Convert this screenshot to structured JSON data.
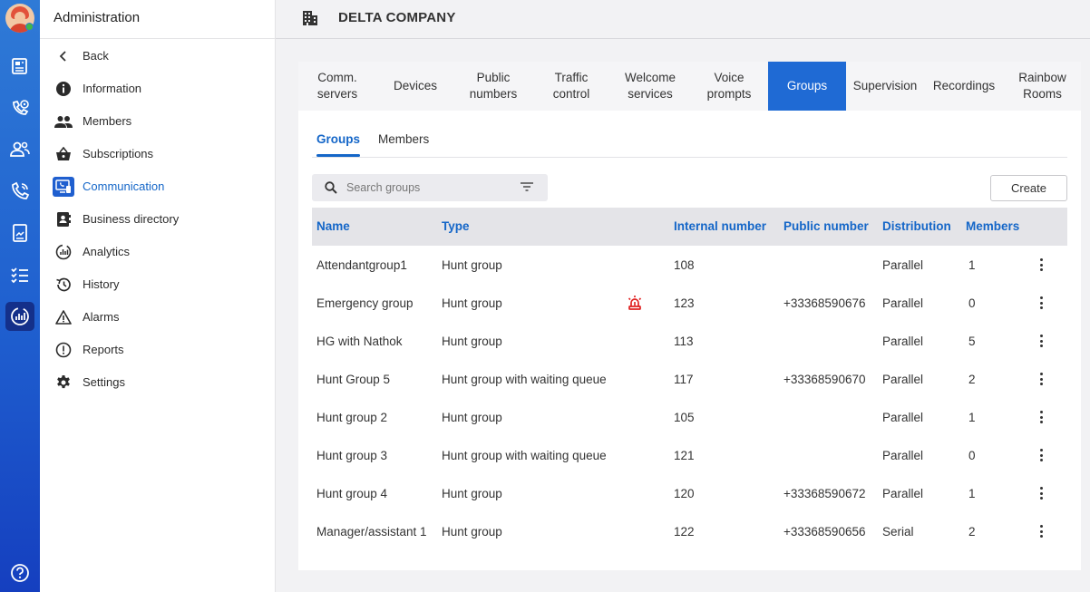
{
  "sidebar_rail": {
    "icons": [
      "avatar",
      "news-icon",
      "phone-settings-icon",
      "contacts-icon",
      "call-icon",
      "document-icon",
      "checklist-icon",
      "admin-dashboard-icon",
      "help-icon"
    ]
  },
  "menu": {
    "title": "Administration",
    "items": [
      {
        "label": "Back",
        "icon": "chevron-left-icon"
      },
      {
        "label": "Information",
        "icon": "info-icon"
      },
      {
        "label": "Members",
        "icon": "people-icon"
      },
      {
        "label": "Subscriptions",
        "icon": "basket-icon"
      },
      {
        "label": "Communication",
        "icon": "communication-icon",
        "selected": true
      },
      {
        "label": "Business directory",
        "icon": "directory-icon"
      },
      {
        "label": "Analytics",
        "icon": "analytics-icon"
      },
      {
        "label": "History",
        "icon": "history-icon"
      },
      {
        "label": "Alarms",
        "icon": "warning-icon"
      },
      {
        "label": "Reports",
        "icon": "report-icon"
      },
      {
        "label": "Settings",
        "icon": "gear-icon"
      }
    ]
  },
  "header": {
    "company": "DELTA COMPANY",
    "icon": "building-icon"
  },
  "tabs": [
    {
      "label": "Comm.\nservers"
    },
    {
      "label": "Devices"
    },
    {
      "label": "Public\nnumbers"
    },
    {
      "label": "Traffic\ncontrol"
    },
    {
      "label": "Welcome\nservices"
    },
    {
      "label": "Voice\nprompts"
    },
    {
      "label": "Groups",
      "active": true
    },
    {
      "label": "Supervision"
    },
    {
      "label": "Recordings"
    },
    {
      "label": "Rainbow\nRooms"
    }
  ],
  "subtabs": [
    {
      "label": "Groups",
      "active": true
    },
    {
      "label": "Members"
    }
  ],
  "search": {
    "placeholder": "Search groups"
  },
  "create_label": "Create",
  "table": {
    "columns": [
      "Name",
      "Type",
      "Internal number",
      "Public number",
      "Distribution",
      "Members"
    ],
    "rows": [
      {
        "name": "Attendantgroup1",
        "type": "Hunt group",
        "alarm": false,
        "internal": "108",
        "public": "",
        "distribution": "Parallel",
        "members": "1"
      },
      {
        "name": "Emergency group",
        "type": "Hunt group",
        "alarm": true,
        "internal": "123",
        "public": "+33368590676",
        "distribution": "Parallel",
        "members": "0"
      },
      {
        "name": "HG with Nathok",
        "type": "Hunt group",
        "alarm": false,
        "internal": "113",
        "public": "",
        "distribution": "Parallel",
        "members": "5"
      },
      {
        "name": "Hunt Group 5",
        "type": "Hunt group with waiting queue",
        "alarm": false,
        "internal": "117",
        "public": "+33368590670",
        "distribution": "Parallel",
        "members": "2"
      },
      {
        "name": "Hunt group 2",
        "type": "Hunt group",
        "alarm": false,
        "internal": "105",
        "public": "",
        "distribution": "Parallel",
        "members": "1"
      },
      {
        "name": "Hunt group 3",
        "type": "Hunt group with waiting queue",
        "alarm": false,
        "internal": "121",
        "public": "",
        "distribution": "Parallel",
        "members": "0"
      },
      {
        "name": "Hunt group 4",
        "type": "Hunt group",
        "alarm": false,
        "internal": "120",
        "public": "+33368590672",
        "distribution": "Parallel",
        "members": "1"
      },
      {
        "name": "Manager/assistant 1",
        "type": "Hunt group",
        "alarm": false,
        "internal": "122",
        "public": "+33368590656",
        "distribution": "Serial",
        "members": "2"
      }
    ]
  },
  "colors": {
    "accent": "#1466c8",
    "active_tab": "#1f6ad4",
    "alarm": "#e02020",
    "rail_top": "#2f7ad6",
    "rail_bottom": "#153fbf"
  }
}
